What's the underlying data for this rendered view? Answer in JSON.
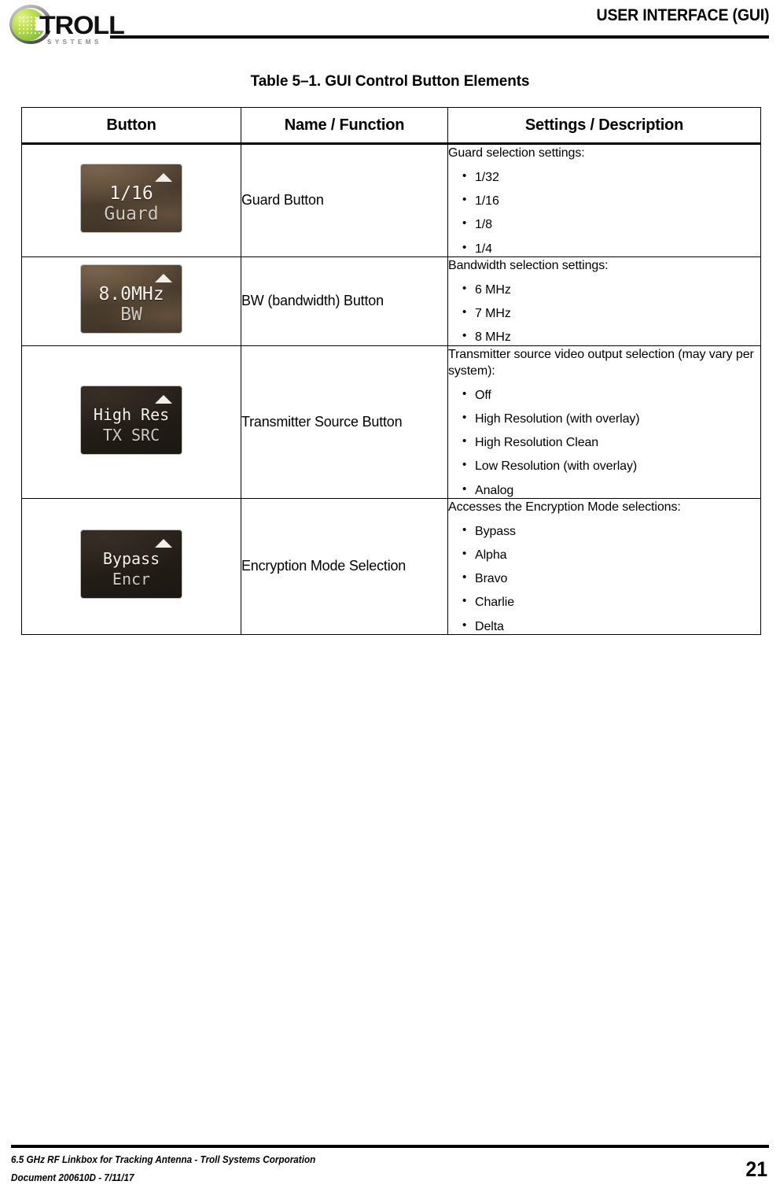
{
  "header": {
    "title": "USER INTERFACE (GUI)",
    "logo": {
      "wordmark": "TROLL",
      "tagline": "SYSTEMS",
      "green": "#8cc63f",
      "gray": "#8a8a8a"
    }
  },
  "table": {
    "title": "Table 5–1.  GUI Control Button Elements",
    "columns": [
      "Button",
      "Name / Function",
      "Settings / Description"
    ],
    "rows": [
      {
        "button": {
          "line1": "1/16",
          "line2": "Guard",
          "style": "brown",
          "arrow": "up-triangle-icon"
        },
        "name": "Guard Button",
        "intro": "Guard selection settings:",
        "items": [
          "1/32",
          "1/16",
          "1/8",
          "1/4"
        ]
      },
      {
        "button": {
          "line1": "8.0MHz",
          "line2": "BW",
          "style": "brown",
          "arrow": "up-triangle-icon"
        },
        "name": "BW (bandwidth) Button",
        "intro": "Bandwidth selection settings:",
        "items": [
          "6 MHz",
          "7 MHz",
          "8 MHz"
        ]
      },
      {
        "button": {
          "line1": "High Res",
          "line2": "TX SRC",
          "style": "dark",
          "arrow": "up-triangle-icon"
        },
        "name": "Transmitter Source Button",
        "intro": "Transmitter source video output selection (may vary per system):",
        "items": [
          "Off",
          "High Resolution (with overlay)",
          "High Resolution Clean",
          "Low Resolution (with overlay)",
          "Analog"
        ]
      },
      {
        "button": {
          "line1": "Bypass",
          "line2": "Encr",
          "style": "dark",
          "arrow": "up-triangle-icon"
        },
        "name": "Encryption Mode Selection",
        "intro": "Accesses the Encryption Mode selections:",
        "items": [
          "Bypass",
          "Alpha",
          "Bravo",
          "Charlie",
          "Delta"
        ]
      }
    ]
  },
  "footer": {
    "line1": "6.5 GHz RF Linkbox for Tracking Antenna - Troll Systems Corporation",
    "line2": "Document 200610D - 7/11/17",
    "page_number": "21"
  }
}
